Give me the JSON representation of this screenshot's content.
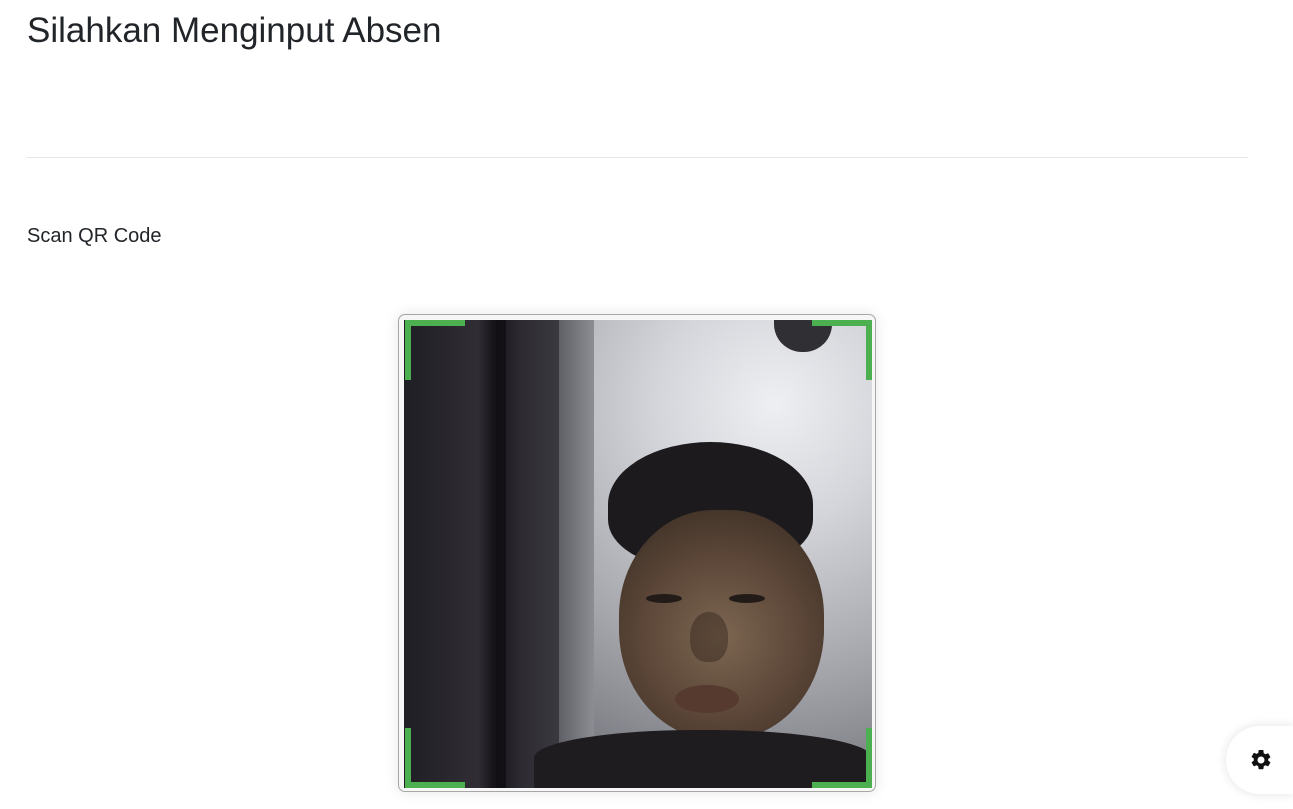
{
  "header": {
    "title": "Silahkan Menginput Absen"
  },
  "scan": {
    "title": "Scan QR Code",
    "accent_color": "#4caf50"
  },
  "settings": {
    "icon": "gear-icon"
  }
}
